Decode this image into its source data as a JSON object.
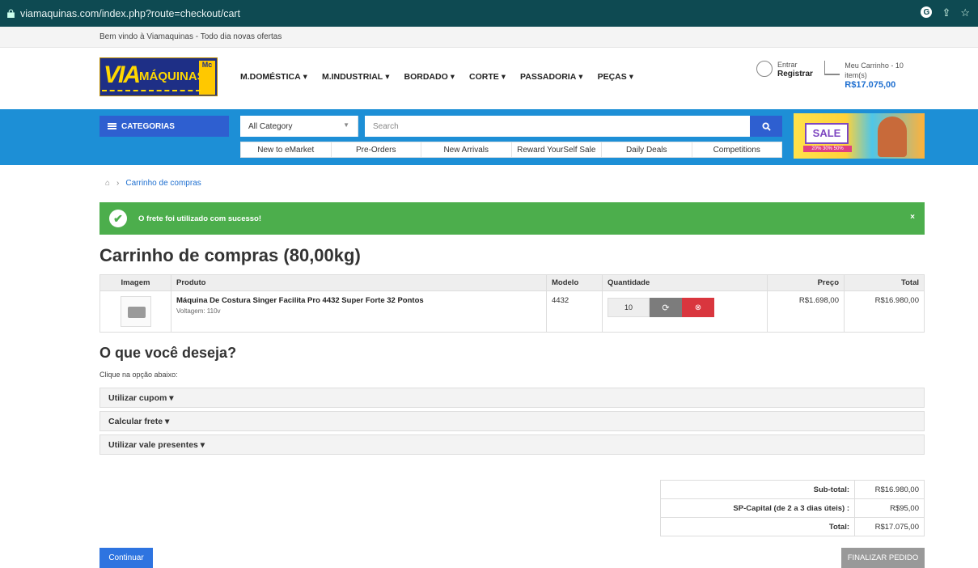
{
  "browser": {
    "url": "viamaquinas.com/index.php?route=checkout/cart",
    "profile_letter": "G"
  },
  "topbar": {
    "welcome": "Bem vindo à Viamaquinas - Todo dia novas ofertas"
  },
  "logo": {
    "via": "VIA",
    "maquinas": "MÁQUINAS",
    "badge": "Mc"
  },
  "nav": [
    {
      "label": "M.DOMÉSTICA"
    },
    {
      "label": "M.INDUSTRIAL"
    },
    {
      "label": "BORDADO"
    },
    {
      "label": "CORTE"
    },
    {
      "label": "PASSADORIA"
    },
    {
      "label": "PEÇAS"
    }
  ],
  "account": {
    "line1": "Entrar",
    "line2": "Registrar"
  },
  "cart_summary": {
    "line1": "Meu Carrinho - 10 item(s)",
    "amount": "R$17.075,00"
  },
  "categories_button": "CATEGORIAS",
  "search": {
    "category": "All Category",
    "placeholder": "Search"
  },
  "sublinks": [
    "New to eMarket",
    "Pre-Orders",
    "New Arrivals",
    "Reward YourSelf Sale",
    "Daily Deals",
    "Competitions"
  ],
  "banner": {
    "sale": "SALE",
    "percents": "20%  30%  50%"
  },
  "breadcrumb": {
    "current": "Carrinho de compras"
  },
  "alert": {
    "message": "O frete foi utilizado com sucesso!",
    "close": "×"
  },
  "page_title": "Carrinho de compras  (80,00kg)",
  "table": {
    "headers": {
      "image": "Imagem",
      "product": "Produto",
      "model": "Modelo",
      "qty": "Quantidade",
      "price": "Preço",
      "total": "Total"
    },
    "row": {
      "product": "Máquina De Costura Singer Facilita Pro 4432 Super Forte 32 Pontos",
      "option": "Voltagem: 110v",
      "model": "4432",
      "qty": "10",
      "price": "R$1.698,00",
      "total": "R$16.980,00"
    }
  },
  "want": {
    "title": "O que você deseja?",
    "hint": "Clique na opção abaixo:"
  },
  "panels": [
    "Utilizar cupom ▾",
    "Calcular frete ▾",
    "Utilizar vale presentes ▾"
  ],
  "totals": [
    {
      "label": "Sub-total:",
      "value": "R$16.980,00"
    },
    {
      "label": "SP-Capital (de 2 a 3 dias úteis) :",
      "value": "R$95,00"
    },
    {
      "label": "Total:",
      "value": "R$17.075,00"
    }
  ],
  "buttons": {
    "continue": "Continuar",
    "checkout": "FINALIZAR PEDIDO"
  }
}
